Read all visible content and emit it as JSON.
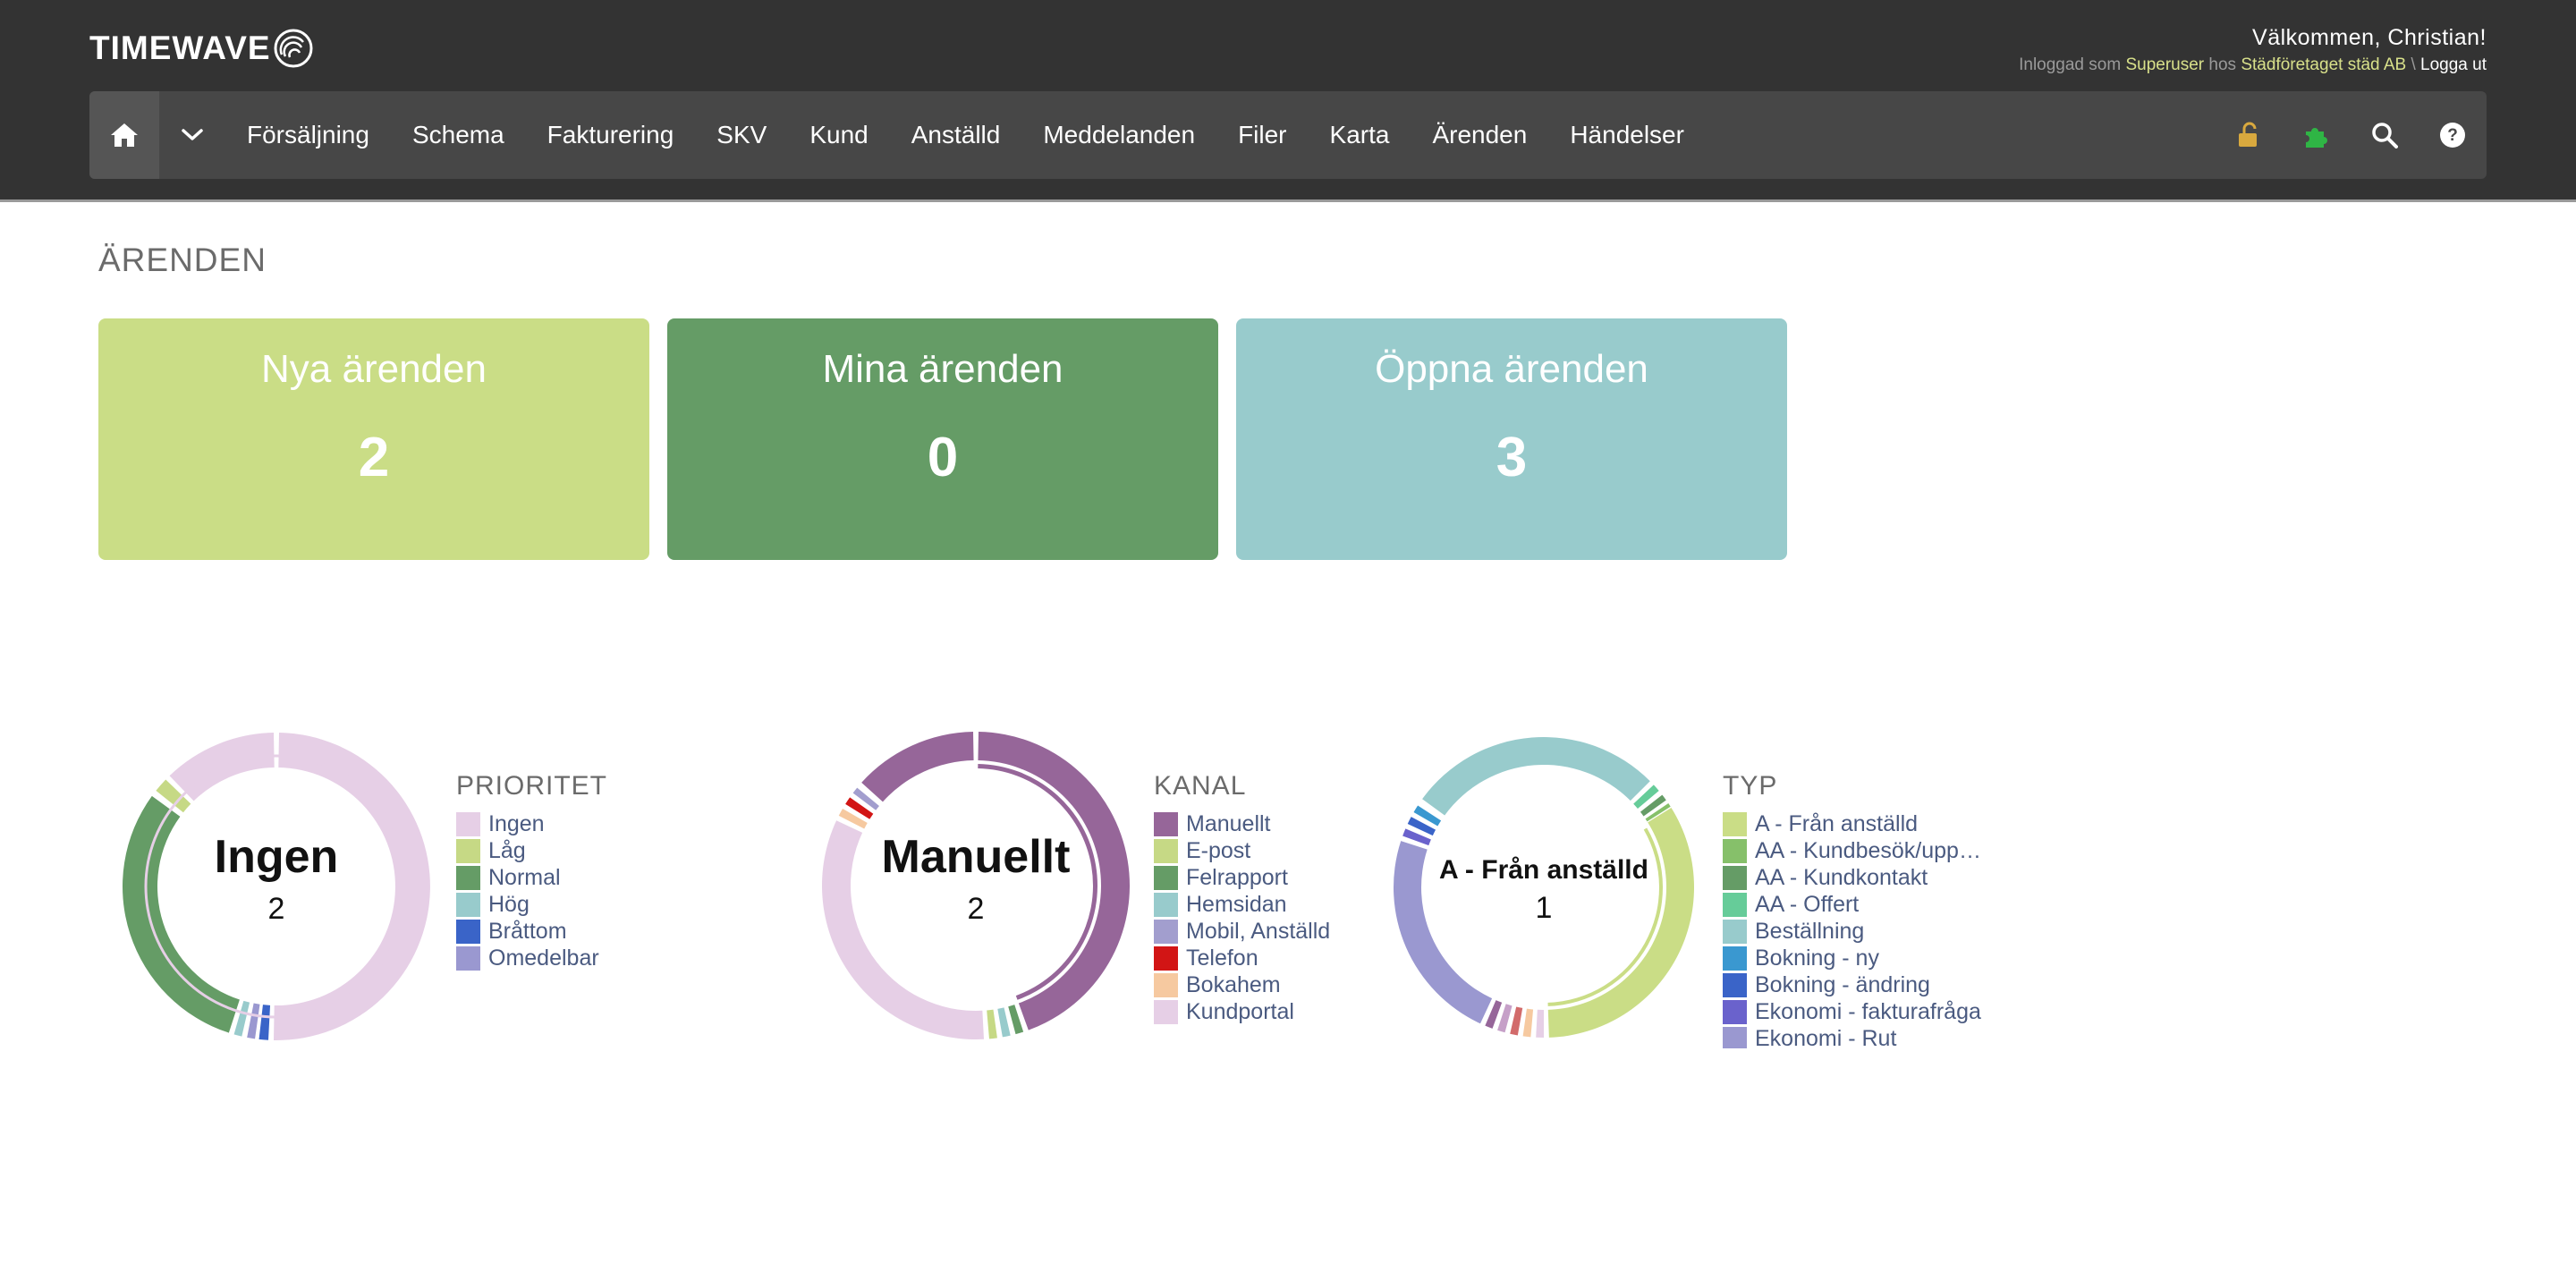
{
  "header": {
    "logo_text": "TIMEWAVE",
    "welcome": "Välkommen, Christian!",
    "login_prefix": "Inloggad som",
    "user_role": "Superuser",
    "login_mid": "hos",
    "company": "Städföretaget städ AB",
    "separator": "\\",
    "logout": "Logga ut"
  },
  "nav": {
    "items": [
      "Försäljning",
      "Schema",
      "Fakturering",
      "SKV",
      "Kund",
      "Anställd",
      "Meddelanden",
      "Filer",
      "Karta",
      "Ärenden",
      "Händelser"
    ],
    "icons": [
      "home-icon",
      "chevron-down-icon",
      "unlock-icon",
      "puzzle-icon",
      "search-icon",
      "help-icon"
    ]
  },
  "page": {
    "title": "ÄRENDEN"
  },
  "tiles": [
    {
      "label": "Nya ärenden",
      "count": "2",
      "color": "#cadd86"
    },
    {
      "label": "Mina ärenden",
      "count": "0",
      "color": "#659c66"
    },
    {
      "label": "Öppna ärenden",
      "count": "3",
      "color": "#98cbcc"
    }
  ],
  "charts": {
    "prioritet": {
      "title": "PRIORITET",
      "center_label": "Ingen",
      "center_value": "2",
      "legend": [
        {
          "name": "Ingen",
          "color": "#e6cfe6"
        },
        {
          "name": "Låg",
          "color": "#c6d985"
        },
        {
          "name": "Normal",
          "color": "#659c66"
        },
        {
          "name": "Hög",
          "color": "#98cbcc"
        },
        {
          "name": "Bråttom",
          "color": "#3a64c8"
        },
        {
          "name": "Omedelbar",
          "color": "#9a98d0"
        }
      ]
    },
    "kanal": {
      "title": "KANAL",
      "center_label": "Manuellt",
      "center_value": "2",
      "legend": [
        {
          "name": "Manuellt",
          "color": "#966699"
        },
        {
          "name": "E-post",
          "color": "#c6d985"
        },
        {
          "name": "Felrapport",
          "color": "#659c66"
        },
        {
          "name": "Hemsidan",
          "color": "#98cbcc"
        },
        {
          "name": "Mobil, Anställd",
          "color": "#a29ece"
        },
        {
          "name": "Telefon",
          "color": "#d21515"
        },
        {
          "name": "Bokahem",
          "color": "#f6c9a0"
        },
        {
          "name": "Kundportal",
          "color": "#e6cfe6"
        }
      ]
    },
    "typ": {
      "title": "TYP",
      "center_label": "A - Från anställd",
      "center_value": "1",
      "legend": [
        {
          "name": "A - Från anställd",
          "color": "#cadd86"
        },
        {
          "name": "AA - Kundbesök/upp…",
          "color": "#86c06a"
        },
        {
          "name": "AA - Kundkontakt",
          "color": "#659c66"
        },
        {
          "name": "AA - Offert",
          "color": "#66cc99"
        },
        {
          "name": "Beställning",
          "color": "#98cbcc"
        },
        {
          "name": "Bokning - ny",
          "color": "#3a98d0"
        },
        {
          "name": "Bokning - ändring",
          "color": "#3a64c8"
        },
        {
          "name": "Ekonomi - fakturafråga",
          "color": "#6a62cc"
        },
        {
          "name": "Ekonomi - Rut",
          "color": "#9a98d0"
        }
      ]
    }
  }
}
